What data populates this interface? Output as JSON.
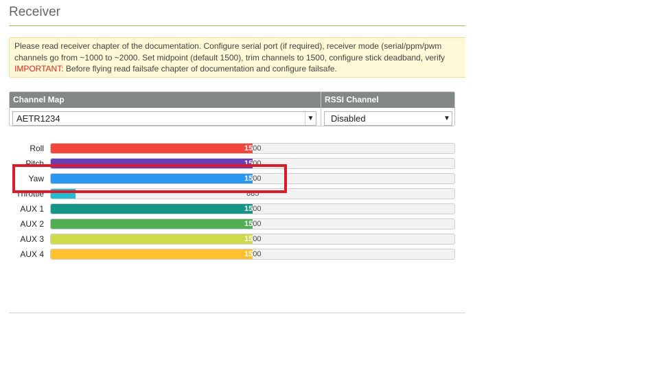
{
  "page": {
    "title": "Receiver"
  },
  "note": {
    "line1": "Please read receiver chapter of the documentation. Configure serial port (if required), receiver mode (serial/ppm/pwm",
    "line2": "channels go from ~1000 to ~2000. Set midpoint (default 1500), trim channels to 1500, configure stick deadband, verify",
    "important_label": "IMPORTANT:",
    "line3_rest": " Before flying read failsafe chapter of documentation and configure failsafe."
  },
  "channel_map": {
    "header": "Channel Map",
    "value": "AETR1234"
  },
  "rssi_channel": {
    "header": "RSSI Channel",
    "value": "Disabled"
  },
  "channel_range": {
    "min": 800,
    "max": 2200
  },
  "channels": [
    {
      "label": "Roll",
      "value": 1500,
      "display": "1500",
      "color": "#f1453d"
    },
    {
      "label": "Pitch",
      "value": 1500,
      "display": "1500",
      "color": "#673fb4"
    },
    {
      "label": "Yaw",
      "value": 1500,
      "display": "1500",
      "color": "#2b98f0"
    },
    {
      "label": "Throttle",
      "value": 885,
      "display": "885",
      "color": "#1fbcd2"
    },
    {
      "label": "AUX 1",
      "value": 1500,
      "display": "1500",
      "color": "#159588"
    },
    {
      "label": "AUX 2",
      "value": 1500,
      "display": "1500",
      "color": "#50ae55"
    },
    {
      "label": "AUX 3",
      "value": 1500,
      "display": "1500",
      "color": "#cdda49"
    },
    {
      "label": "AUX 4",
      "value": 1500,
      "display": "1500",
      "color": "#fdc02f"
    }
  ],
  "highlight": {
    "target": "Yaw",
    "color": "#dd1c2b"
  }
}
